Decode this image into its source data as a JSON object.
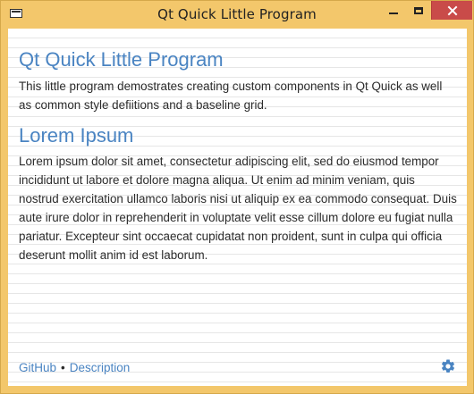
{
  "window": {
    "title": "Qt Quick Little Program"
  },
  "content": {
    "heading_1": "Qt Quick Little Program",
    "paragraph_1": "This little program demostrates creating custom components in Qt Quick as well as common style defiitions and a baseline grid.",
    "heading_2": "Lorem Ipsum",
    "paragraph_2": "Lorem ipsum dolor sit amet, consectetur adipiscing elit, sed do eiusmod tempor incididunt ut labore et dolore magna aliqua. Ut enim ad minim veniam, quis nostrud exercitation ullamco laboris nisi ut aliquip ex ea commodo consequat. Duis aute irure dolor in reprehenderit in voluptate velit esse cillum dolore eu fugiat nulla pariatur. Excepteur sint occaecat cupidatat non proident, sunt in culpa qui officia deserunt mollit anim id est laborum."
  },
  "footer": {
    "github_link": "GitHub",
    "separator": "•",
    "description_link": "Description"
  },
  "icons": {
    "app": "app-window-icon",
    "minimize": "minimize-icon",
    "maximize": "maximize-icon",
    "close": "close-icon",
    "settings": "gear-icon"
  },
  "colors": {
    "titlebar": "#f3c76b",
    "close_button": "#c94b49",
    "accent": "#4a84c2",
    "text": "#2b2b2b",
    "grid": "#e6e6e6"
  }
}
